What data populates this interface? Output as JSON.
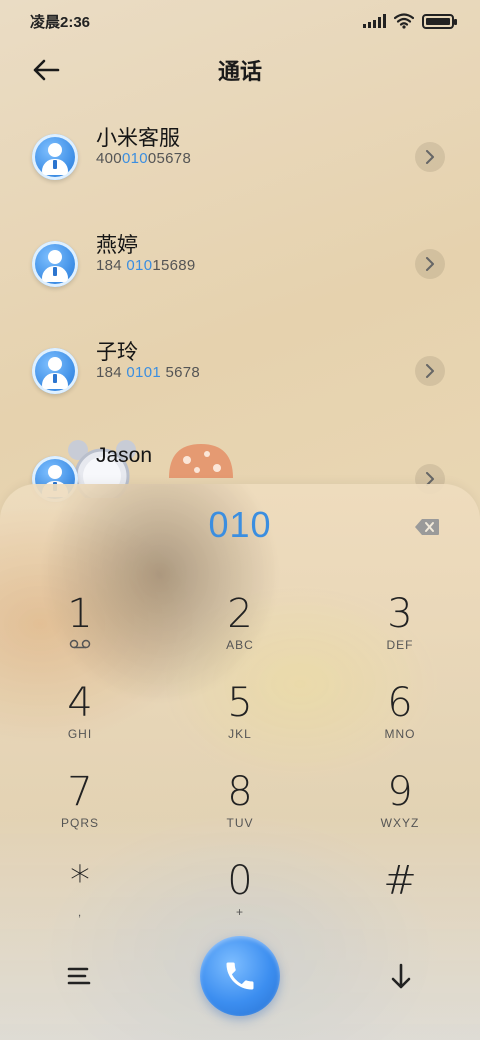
{
  "status_bar": {
    "time": "凌晨2:36",
    "icons": [
      "signal-icon",
      "wifi-icon",
      "battery-icon"
    ]
  },
  "header": {
    "title": "通话",
    "back_icon": "back-arrow-icon"
  },
  "contacts": [
    {
      "name": "小米客服",
      "number_pre": "400",
      "number_hl": "010",
      "number_post": "05678"
    },
    {
      "name": "燕婷",
      "number_pre": "184 ",
      "number_hl": "010",
      "number_post": "15689"
    },
    {
      "name": "子玲",
      "number_pre": "184 ",
      "number_hl": "0101",
      "number_post": " 5678"
    },
    {
      "name": "Jason",
      "number_pre": "",
      "number_hl": "",
      "number_post": ""
    }
  ],
  "dialpad": {
    "dialed": "010",
    "keys": [
      {
        "digit": "1",
        "letters": ""
      },
      {
        "digit": "2",
        "letters": "ABC"
      },
      {
        "digit": "3",
        "letters": "DEF"
      },
      {
        "digit": "4",
        "letters": "GHI"
      },
      {
        "digit": "5",
        "letters": "JKL"
      },
      {
        "digit": "6",
        "letters": "MNO"
      },
      {
        "digit": "7",
        "letters": "PQRS"
      },
      {
        "digit": "8",
        "letters": "TUV"
      },
      {
        "digit": "9",
        "letters": "WXYZ"
      },
      {
        "digit": "*",
        "letters": ","
      },
      {
        "digit": "0",
        "letters": "+"
      },
      {
        "digit": "#",
        "letters": ""
      }
    ]
  },
  "colors": {
    "accent": "#3b8ee0",
    "call_button": "#3c8ef0"
  }
}
